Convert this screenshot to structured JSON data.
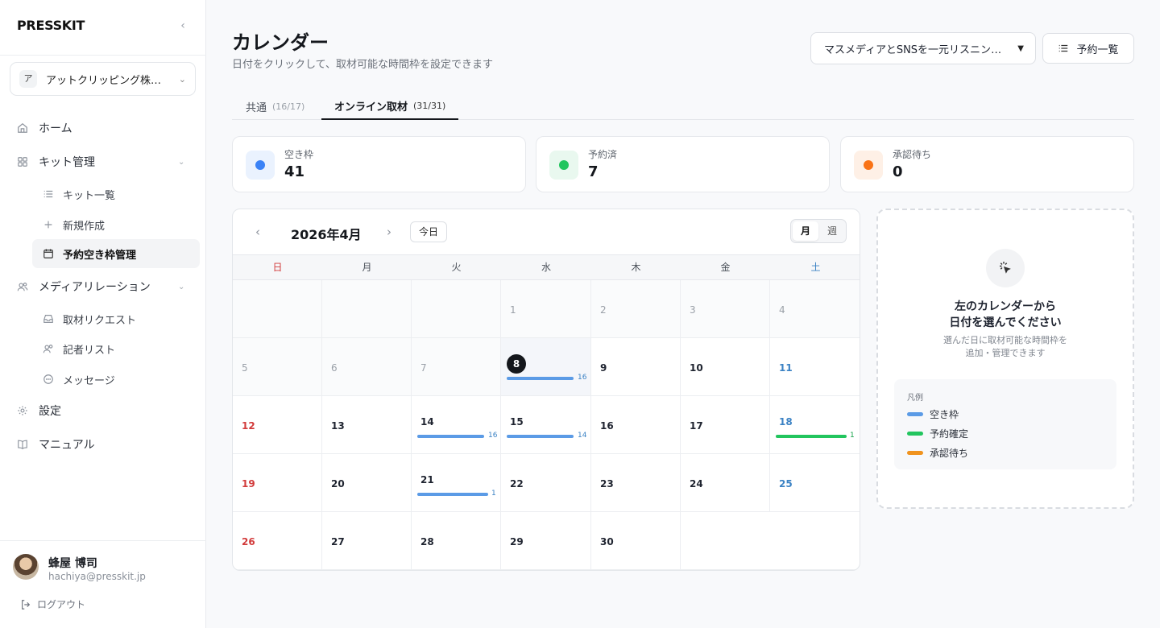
{
  "app": {
    "logo": "PRESSKIT"
  },
  "org": {
    "badge": "ア",
    "name": "アットクリッピング株式会社"
  },
  "nav": {
    "home": "ホーム",
    "kit": "キット管理",
    "kit_list": "キット一覧",
    "kit_new": "新規作成",
    "slots": "予約空き枠管理",
    "media": "メディアリレーション",
    "requests": "取材リクエスト",
    "journalists": "記者リスト",
    "messages": "メッセージ",
    "settings": "設定",
    "manual": "マニュアル"
  },
  "user": {
    "name": "蜂屋 博司",
    "email": "hachiya@presskit.jp",
    "logout": "ログアウト"
  },
  "page": {
    "title": "カレンダー",
    "subtitle": "日付をクリックして、取材可能な時間枠を設定できます"
  },
  "kit_select": {
    "value": "マスメディアとSNSを一元リスニングできるツール"
  },
  "reservations_button": "予約一覧",
  "tabs": [
    {
      "label": "共通",
      "count": "(16/17)"
    },
    {
      "label": "オンライン取材",
      "count": "(31/31)"
    }
  ],
  "stats": [
    {
      "label": "空き枠",
      "value": "41",
      "color": "#3b82f6",
      "bg": "#eaf2fe"
    },
    {
      "label": "予約済",
      "value": "7",
      "color": "#22c55e",
      "bg": "#e9f8ef"
    },
    {
      "label": "承認待ち",
      "value": "0",
      "color": "#f97316",
      "bg": "#fef0e6"
    }
  ],
  "calendar": {
    "month_label": "2026年4月",
    "today_label": "今日",
    "view_month": "月",
    "view_week": "週",
    "weekdays": [
      "日",
      "月",
      "火",
      "水",
      "木",
      "金",
      "土"
    ],
    "weeks": [
      [
        {
          "d": "",
          "dim": true
        },
        {
          "d": "",
          "dim": true
        },
        {
          "d": "",
          "dim": true
        },
        {
          "d": "1",
          "dim": true
        },
        {
          "d": "2",
          "dim": true
        },
        {
          "d": "3",
          "dim": true
        },
        {
          "d": "4",
          "dim": true
        }
      ],
      [
        {
          "d": "5",
          "dim": true
        },
        {
          "d": "6",
          "dim": true
        },
        {
          "d": "7",
          "dim": true
        },
        {
          "d": "8",
          "selected": true,
          "bar": "open",
          "count": "16"
        },
        {
          "d": "9"
        },
        {
          "d": "10"
        },
        {
          "d": "11"
        }
      ],
      [
        {
          "d": "12"
        },
        {
          "d": "13"
        },
        {
          "d": "14",
          "bar": "open",
          "count": "16"
        },
        {
          "d": "15",
          "bar": "open",
          "count": "14"
        },
        {
          "d": "16"
        },
        {
          "d": "17"
        },
        {
          "d": "18",
          "bar": "booked",
          "count": "1"
        }
      ],
      [
        {
          "d": "19"
        },
        {
          "d": "20"
        },
        {
          "d": "21",
          "bar": "open",
          "count": "1"
        },
        {
          "d": "22"
        },
        {
          "d": "23"
        },
        {
          "d": "24"
        },
        {
          "d": "25"
        }
      ],
      [
        {
          "d": "26"
        },
        {
          "d": "27"
        },
        {
          "d": "28"
        },
        {
          "d": "29"
        },
        {
          "d": "30"
        },
        {
          "d": "",
          "blank": true
        },
        {
          "d": "",
          "blank": true
        }
      ]
    ]
  },
  "panel": {
    "title_line1": "左のカレンダーから",
    "title_line2": "日付を選んでください",
    "desc_line1": "選んだ日に取材可能な時間枠を",
    "desc_line2": "追加・管理できます",
    "legend_title": "凡例",
    "legend": [
      {
        "label": "空き枠",
        "color": "#5b9be6"
      },
      {
        "label": "予約確定",
        "color": "#22c55e"
      },
      {
        "label": "承認待ち",
        "color": "#f0931e"
      }
    ]
  },
  "colors": {
    "open": "#5b9be6",
    "booked": "#22c55e",
    "open_text": "#3b82c4",
    "booked_text": "#16a34a"
  }
}
